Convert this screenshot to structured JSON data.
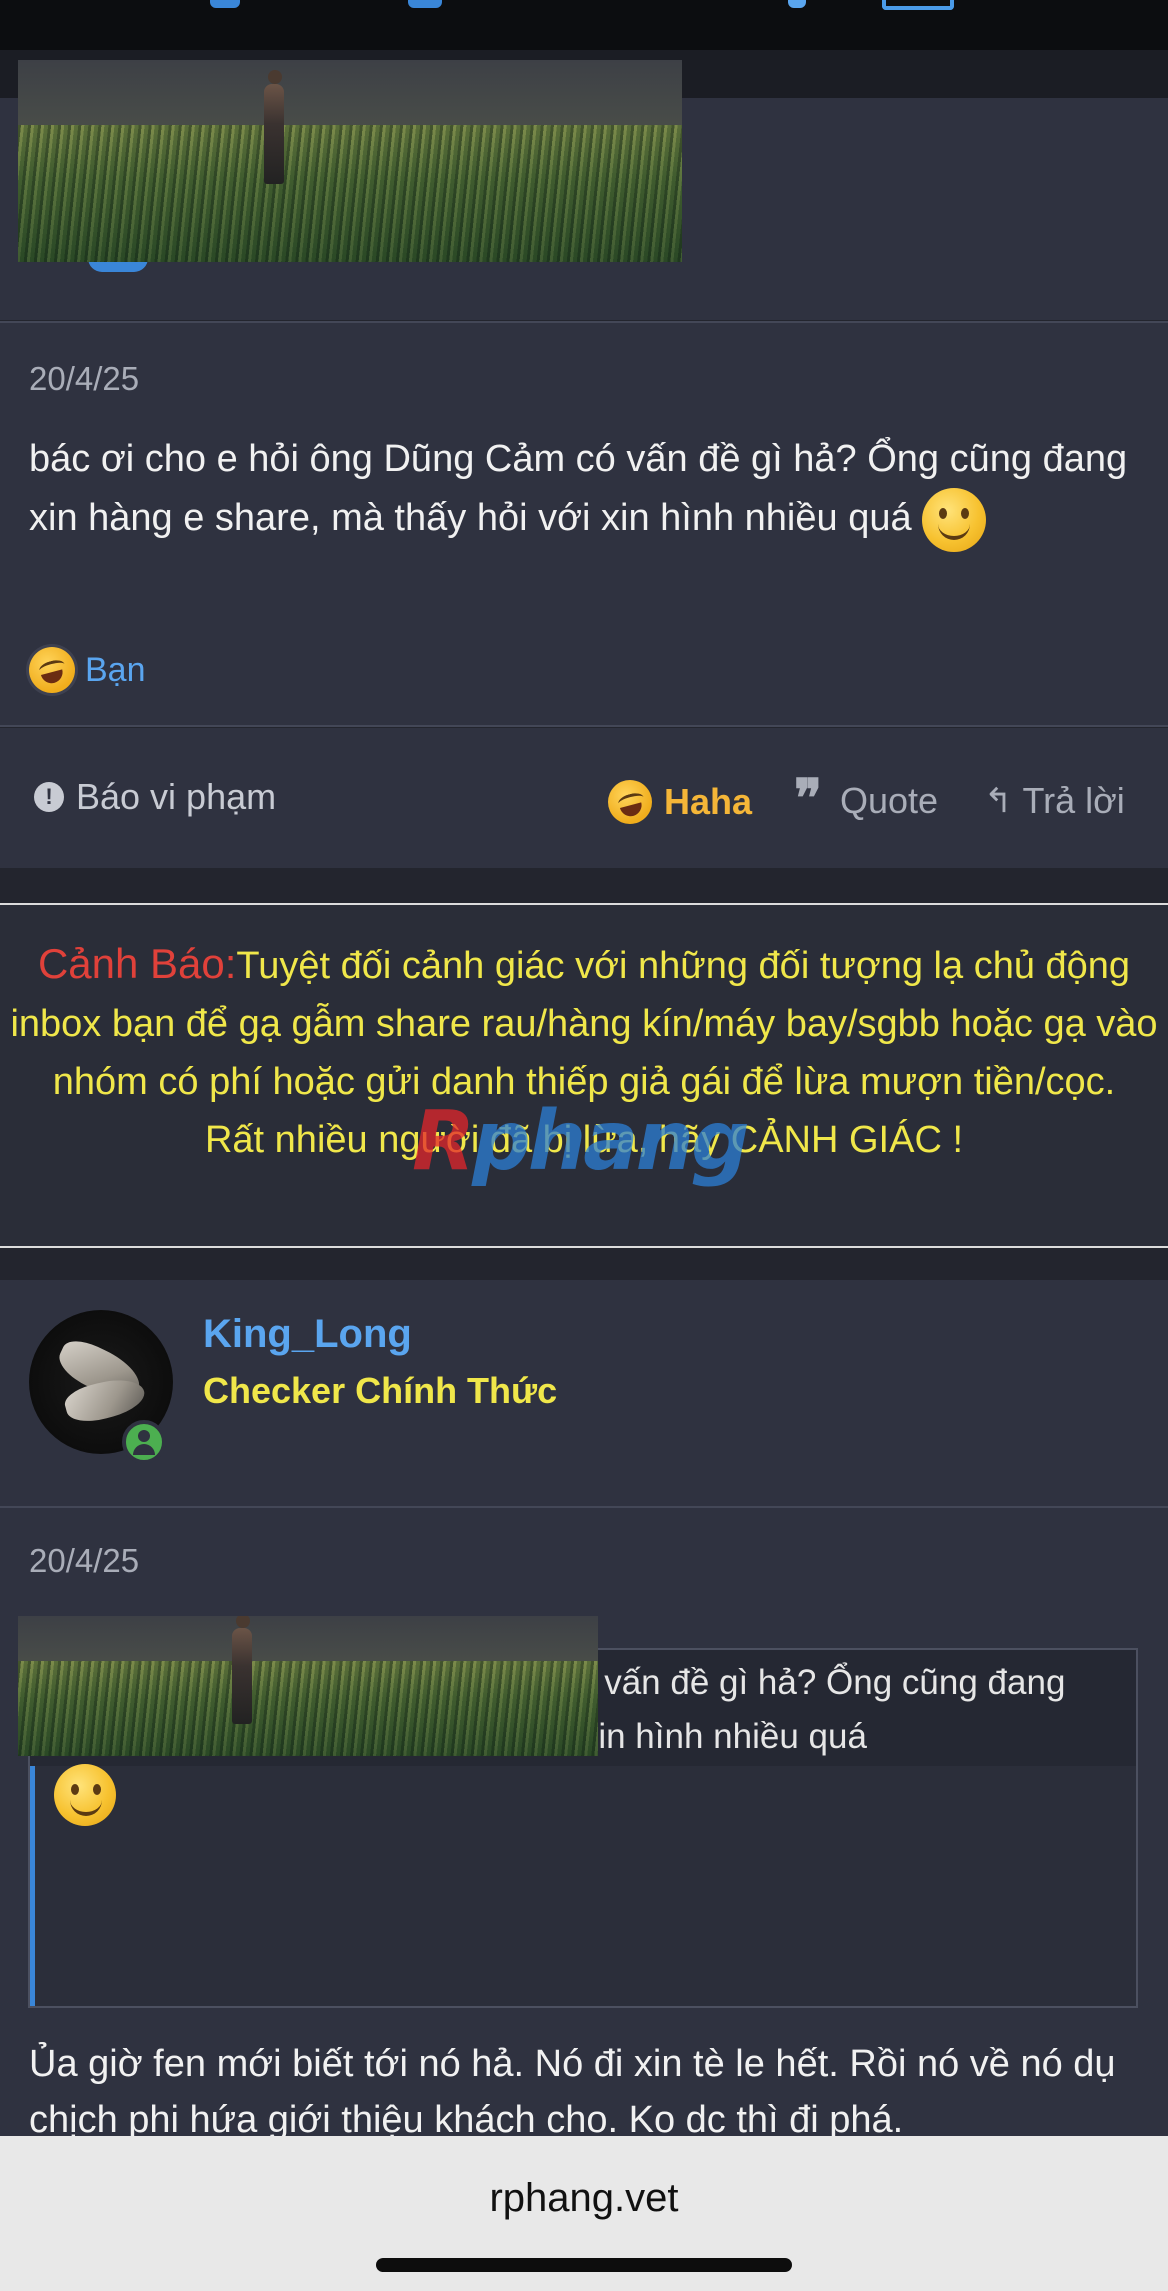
{
  "post1": {
    "date": "20/4/25",
    "text": "bác ơi cho e hỏi ông Dũng Cảm có vấn đề gì hả? Ổng cũng đang xin hàng e share, mà thấy hỏi với xin hình nhiều quá",
    "reactions_label": "Bạn"
  },
  "actions": {
    "report": "Báo vi phạm",
    "haha": "Haha",
    "quote": "Quote",
    "reply": "Trả lời"
  },
  "warning": {
    "label": "Cảnh Báo:",
    "text": "Tuyệt đối cảnh giác với những đối tượng lạ chủ động inbox bạn để gạ gẫm share rau/hàng kín/máy bay/sgbb hoặc gạ vào nhóm có phí hoặc gửi danh thiếp giả gái để lừa mượn tiền/cọc.",
    "footer": "Rất nhiều người đã bị lừa, hãy CẢNH GIÁC !"
  },
  "logo": {
    "part1": "R",
    "part2": "phang"
  },
  "user": {
    "name": "King_Long",
    "title": "Checker Chính Thức"
  },
  "post2": {
    "date": "20/4/25",
    "quote_text": "bác ơi cho e hỏi ông Dũng Cảm có vấn đề gì hả? Ổng cũng đang xin hàng e share, mà thấy hỏi với xin hình nhiều quá",
    "reply_text": "Ủa giờ fen mới biết tới nó hả. Nó đi xin tè le hết. Rồi nó về nó dụ chịch phi hứa giới thiệu khách cho. Ko dc thì đi phá."
  },
  "browser": {
    "url": "rphang.vet"
  },
  "colors": {
    "background": "#23252e",
    "panel": "#2f3240",
    "link_blue": "#5aa5ef",
    "warning_yellow": "#f0e74a",
    "warning_red": "#e0413a",
    "haha_orange": "#f5b638"
  }
}
